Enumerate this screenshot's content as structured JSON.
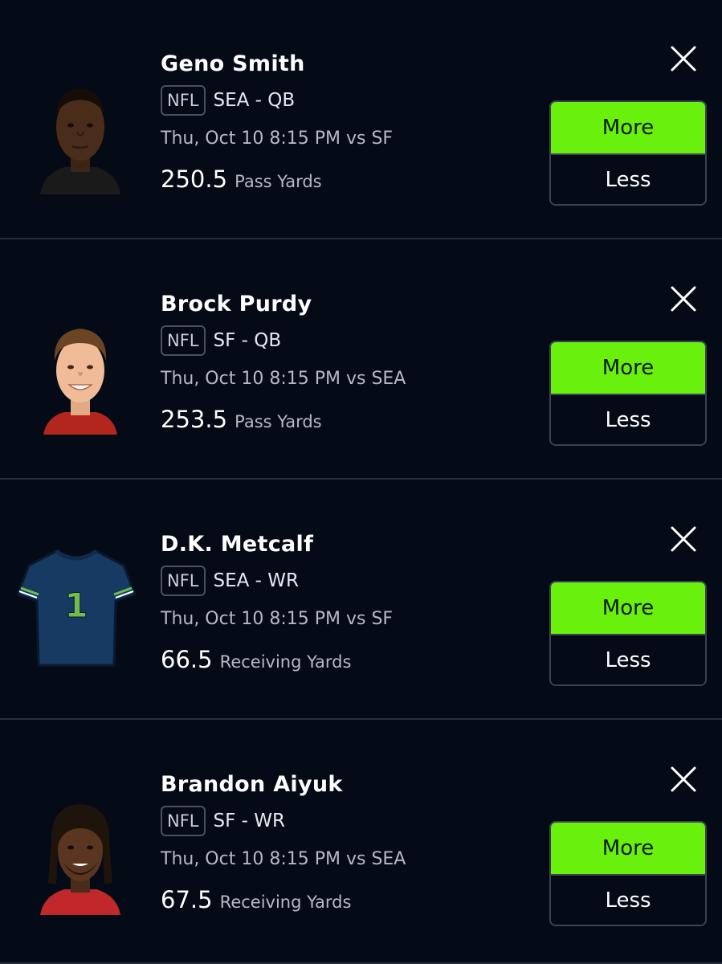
{
  "picks": [
    {
      "player_name": "Geno Smith",
      "league": "NFL",
      "team_position": "SEA - QB",
      "game_time": "Thu, Oct 10 8:15 PM vs SF",
      "line_value": "250.5",
      "stat_type": "Pass Yards",
      "more_label": "More",
      "less_label": "Less",
      "avatar_icon": "player-headshot"
    },
    {
      "player_name": "Brock Purdy",
      "league": "NFL",
      "team_position": "SF - QB",
      "game_time": "Thu, Oct 10 8:15 PM vs SEA",
      "line_value": "253.5",
      "stat_type": "Pass Yards",
      "more_label": "More",
      "less_label": "Less",
      "avatar_icon": "player-headshot"
    },
    {
      "player_name": "D.K. Metcalf",
      "league": "NFL",
      "team_position": "SEA - WR",
      "game_time": "Thu, Oct 10 8:15 PM vs SF",
      "line_value": "66.5",
      "stat_type": "Receiving Yards",
      "more_label": "More",
      "less_label": "Less",
      "avatar_icon": "jersey-icon",
      "jersey_number": "1"
    },
    {
      "player_name": "Brandon Aiyuk",
      "league": "NFL",
      "team_position": "SF - WR",
      "game_time": "Thu, Oct 10 8:15 PM vs SEA",
      "line_value": "67.5",
      "stat_type": "Receiving Yards",
      "more_label": "More",
      "less_label": "Less",
      "avatar_icon": "player-headshot"
    }
  ],
  "colors": {
    "background": "#050a17",
    "more_button": "#6af00d",
    "divider": "#272d3d",
    "secondary_text": "#b5b9c4"
  }
}
